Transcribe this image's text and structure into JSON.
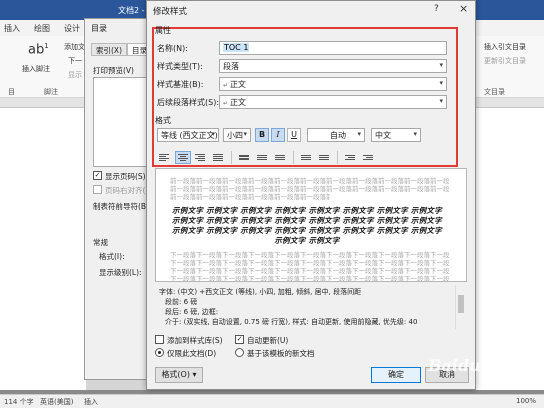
{
  "word": {
    "tabs": [
      "插入",
      "绘图",
      "设计"
    ],
    "title_fragment": "文档2 -",
    "ribbon": {
      "footnote_label": "插入脚注",
      "add_text": "添加文",
      "next_footnote": "下一",
      "show_notes": "显示",
      "footnote_group": "脚注",
      "toc_group_label": "目",
      "citation_insert": "插入引文目录",
      "citation_update": "更新引文目录",
      "citation_group": "文目录"
    },
    "status": {
      "words": "114 个字",
      "language": "英语(美国)",
      "mode": "插入",
      "zoom": "100%"
    }
  },
  "toc_dialog": {
    "title": "目录",
    "tabs": [
      "索引(X)",
      "目录(C)"
    ],
    "print_preview": "打印预览(V)",
    "show_page_numbers": "显示页码(S)",
    "right_align": "页码右对齐(R)",
    "tab_leader": "制表符前导符(B):",
    "general": "常规",
    "formats": "格式(I):",
    "show_levels": "显示级别(L):"
  },
  "dialog": {
    "title": "修改样式",
    "help_icon": "?",
    "close_icon": "×",
    "properties_section": "属性",
    "name_label": "名称(N):",
    "name_value": "TOC 1",
    "style_type_label": "样式类型(T):",
    "style_type_value": "段落",
    "based_on_label": "样式基准(B):",
    "based_on_value": "正文",
    "next_style_label": "后续段落样式(S):",
    "next_style_value": "正文",
    "format_section": "格式",
    "font": "等线 (西文正文)",
    "size": "小四",
    "bold_label": "B",
    "italic_label": "I",
    "underline_label": "U",
    "color": "自动",
    "language": "中文",
    "preview": {
      "prev_paragraph": "前一段落前一段落前一段落前一段落前一段落前一段落前一段落前一段落前一段落前一段落前一段落前一段落前一段落前一段落前一段落前一段落前一段落前一段落前一段落前一段落",
      "sample_line_1": "示例文字 示例文字 示例文字 示例文字 示例文字 示例文字 示例文字 示例文字",
      "sample_line_2": "示例文字 示例文字 示例文字 示例文字 示例文字 示例文字 示例文字 示例文字",
      "sample_line_3": "示例文字 示例文字 示例文字 示例文字 示例文字 示例文字 示例文字 示例文字",
      "sample_line_4": "示例文字 示例文字",
      "next_paragraph": "下一段落下一段落下一段落下一段落下一段落下一段落下一段落下一段落下一段落下一段落下一段落下一段落下一段落下一段落下一段落下一段落下一段落下一段落"
    },
    "description": [
      "字体: (中文) +西文正文 (等线), 小四, 加粗, 倾斜, 居中, 段落间距",
      "段前: 6 磅",
      "段后: 6 磅, 边框:",
      "介于: (双实线, 自动设置, 0.75 磅 行宽), 样式: 自动更新, 使用前隐藏, 优先级: 40"
    ],
    "add_to_gallery": "添加到样式库(S)",
    "auto_update": "自动更新(U)",
    "only_this_doc": "仅限此文档(D)",
    "new_docs": "基于该模板的新文档",
    "format_button": "格式(O) ▾",
    "ok_button": "确定",
    "cancel_button": "取消",
    "highlight_color": "#e53935",
    "accent": "#0078d7"
  },
  "watermark": "Baidu"
}
